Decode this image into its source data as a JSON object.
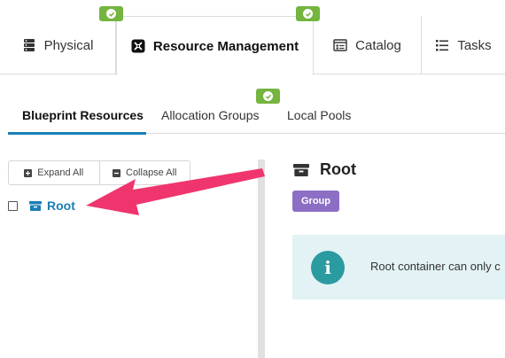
{
  "top_tabs": [
    {
      "label": "Physical",
      "icon": "server-icon"
    },
    {
      "label": "Resource Management",
      "icon": "resource-management-icon"
    },
    {
      "label": "Catalog",
      "icon": "catalog-icon"
    },
    {
      "label": "Tasks",
      "icon": "tasks-list-icon"
    }
  ],
  "active_top_tab": "Resource Management",
  "sub_tabs": [
    {
      "label": "Blueprint Resources"
    },
    {
      "label": "Allocation Groups"
    },
    {
      "label": "Local Pools"
    }
  ],
  "active_sub_tab": "Blueprint Resources",
  "tree": {
    "expand_all": "Expand All",
    "collapse_all": "Collapse All",
    "nodes": [
      {
        "label": "Root",
        "icon": "archive-box-icon",
        "checked": false
      }
    ]
  },
  "detail": {
    "title": "Root",
    "type_badge": "Group",
    "info_message": "Root container can only c"
  },
  "colors": {
    "accent": "#1a7fb4",
    "ok_badge": "#74b43f",
    "group_badge": "#8c6fc4",
    "info_bg": "#e3f2f4",
    "info_icon": "#2a9ba0",
    "annotation_arrow": "#f0356e"
  }
}
